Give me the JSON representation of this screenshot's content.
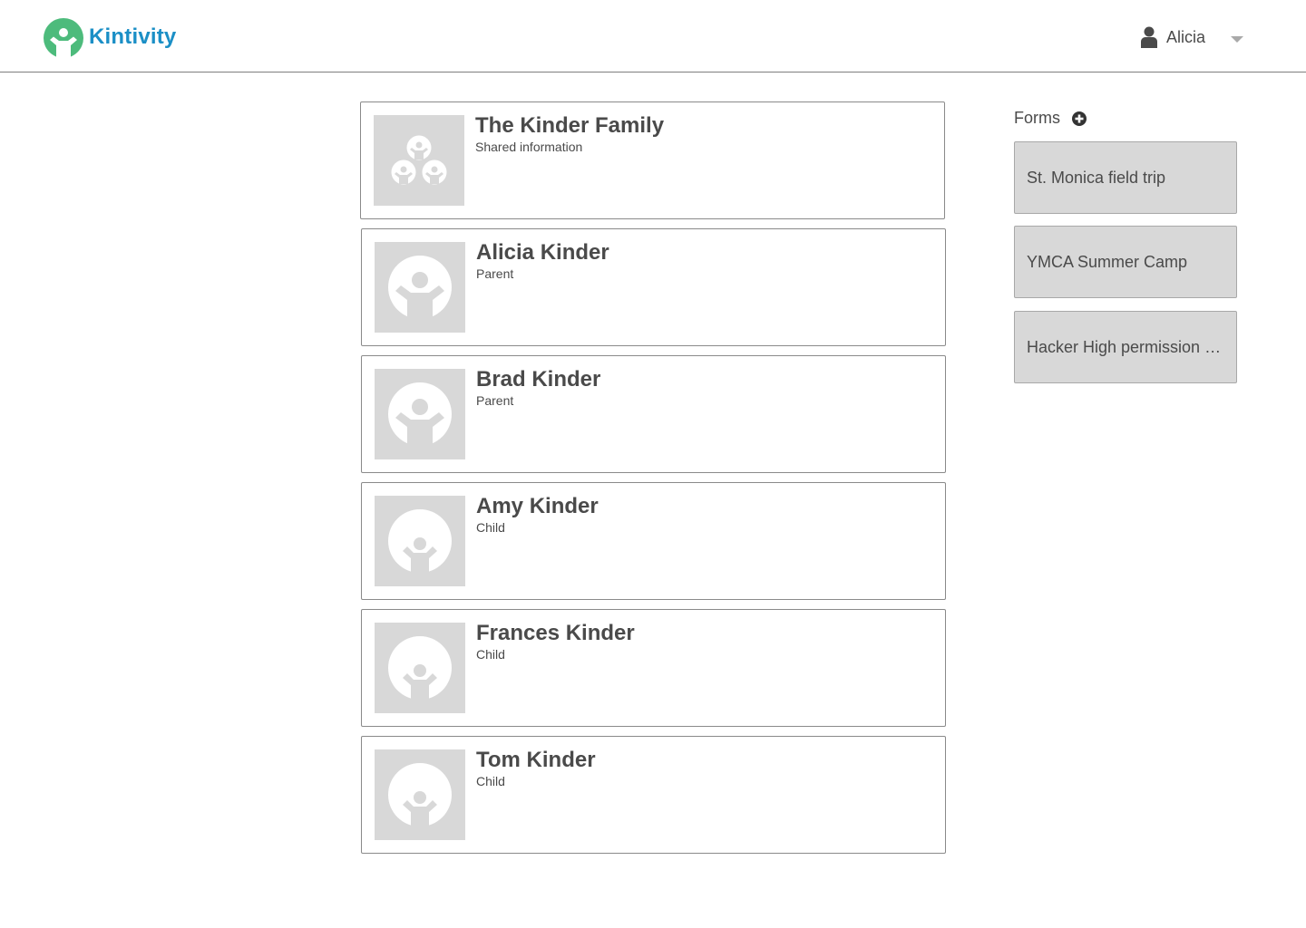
{
  "app": {
    "brand_name": "Kintivity",
    "brand_color": "#1b8fc6",
    "logo_color": "#4dbb7c"
  },
  "header": {
    "user_name": "Alicia",
    "user_icon": "user-icon",
    "menu_icon": "chevron-down-icon"
  },
  "members": [
    {
      "name": "The Kinder Family",
      "role": "Shared information",
      "avatar": "family-group-icon"
    },
    {
      "name": "Alicia Kinder",
      "role": "Parent",
      "avatar": "adult-person-icon"
    },
    {
      "name": "Brad Kinder",
      "role": "Parent",
      "avatar": "adult-person-icon"
    },
    {
      "name": "Amy Kinder",
      "role": "Child",
      "avatar": "child-person-icon"
    },
    {
      "name": "Frances Kinder",
      "role": "Child",
      "avatar": "child-person-icon"
    },
    {
      "name": "Tom Kinder",
      "role": "Child",
      "avatar": "child-person-icon"
    }
  ],
  "forms": {
    "title": "Forms",
    "add_icon": "plus-circle-icon",
    "items": [
      {
        "label": "St. Monica field trip"
      },
      {
        "label": "YMCA Summer Camp"
      },
      {
        "label": "Hacker High permission slip"
      }
    ]
  }
}
